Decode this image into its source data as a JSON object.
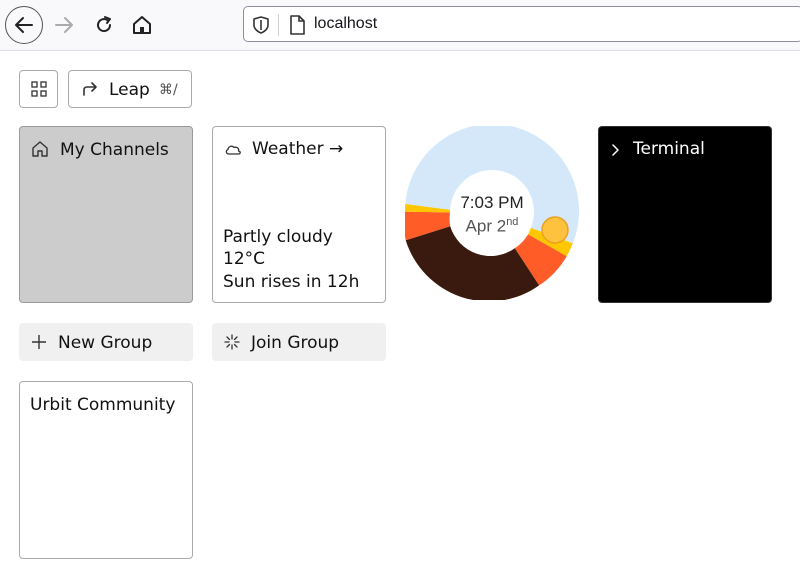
{
  "browser": {
    "url": "localhost"
  },
  "toolbar": {
    "leap_label": "Leap",
    "leap_shortcut": "⌘/"
  },
  "tiles": {
    "channels_label": "My Channels",
    "weather": {
      "title": "Weather →",
      "condition": "Partly cloudy",
      "temperature": "12°C",
      "sunrise": "Sun rises in 12h"
    },
    "clock": {
      "time": "7:03 PM",
      "date": "Apr 2",
      "date_suffix": "nd"
    },
    "terminal_label": "Terminal"
  },
  "groups": {
    "new_label": "New Group",
    "join_label": "Join Group",
    "community_label": "Urbit Community"
  },
  "colors": {
    "sky": "#d4e8fa",
    "night": "#3a1a0f",
    "sunset_orange": "#ff5c28",
    "sunset_yellow": "#ffc700",
    "sun": "#ffc23f"
  }
}
